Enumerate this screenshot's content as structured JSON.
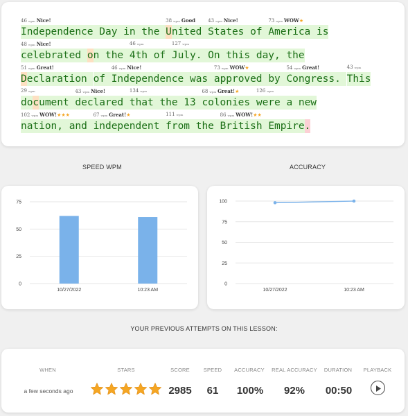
{
  "typing": {
    "lines": [
      {
        "words": [
          {
            "text": "Independence",
            "wpm": "46",
            "label": "Nice!",
            "stars": "",
            "hl": []
          },
          {
            "text": "Day",
            "wpm": "",
            "label": "",
            "stars": "",
            "hl": []
          },
          {
            "text": "in",
            "wpm": "",
            "label": "",
            "stars": "",
            "hl": []
          },
          {
            "text": "the",
            "wpm": "",
            "label": "",
            "stars": "",
            "hl": []
          },
          {
            "text": "United",
            "wpm": "38",
            "label": "Good",
            "stars": "",
            "hl": [
              0
            ]
          },
          {
            "text": "States",
            "wpm": "43",
            "label": "Nice!",
            "stars": "",
            "hl": []
          },
          {
            "text": "of",
            "wpm": "",
            "label": "",
            "stars": "",
            "hl": []
          },
          {
            "text": "America",
            "wpm": "73",
            "label": "WOW",
            "stars": "★",
            "hl": []
          },
          {
            "text": "is",
            "wpm": "",
            "label": "",
            "stars": "",
            "hl": []
          }
        ]
      },
      {
        "words": [
          {
            "text": "celebrated",
            "wpm": "48",
            "label": "Nice!",
            "stars": "",
            "hl": []
          },
          {
            "text": "on",
            "wpm": "",
            "label": "",
            "stars": "",
            "hl": [
              0
            ]
          },
          {
            "text": "the",
            "wpm": "",
            "label": "",
            "stars": "",
            "hl": []
          },
          {
            "text": "4th",
            "wpm": "46",
            "label": "",
            "stars": "",
            "hl": []
          },
          {
            "text": "of",
            "wpm": "",
            "label": "",
            "stars": "",
            "hl": []
          },
          {
            "text": "July.",
            "wpm": "127",
            "label": "",
            "stars": "",
            "hl": []
          },
          {
            "text": "On",
            "wpm": "",
            "label": "",
            "stars": "",
            "hl": []
          },
          {
            "text": "this",
            "wpm": "",
            "label": "",
            "stars": "",
            "hl": []
          },
          {
            "text": "day,",
            "wpm": "",
            "label": "",
            "stars": "",
            "hl": []
          },
          {
            "text": "the",
            "wpm": "",
            "label": "",
            "stars": "",
            "hl": []
          }
        ]
      },
      {
        "words": [
          {
            "text": "Declaration",
            "wpm": "51",
            "label": "Great!",
            "stars": "",
            "hl": [
              0
            ]
          },
          {
            "text": "of",
            "wpm": "",
            "label": "",
            "stars": "",
            "hl": []
          },
          {
            "text": "Independence",
            "wpm": "46",
            "label": "Nice!",
            "stars": "",
            "hl": []
          },
          {
            "text": "was",
            "wpm": "",
            "label": "",
            "stars": "",
            "hl": []
          },
          {
            "text": "approved",
            "wpm": "73",
            "label": "WOW",
            "stars": "★",
            "hl": []
          },
          {
            "text": "by",
            "wpm": "",
            "label": "",
            "stars": "",
            "hl": []
          },
          {
            "text": "Congress.",
            "wpm": "54",
            "label": "Great!",
            "stars": "",
            "hl": []
          },
          {
            "text": "This",
            "wpm": "43",
            "label": "",
            "stars": "",
            "hl": []
          }
        ]
      },
      {
        "words": [
          {
            "text": "document",
            "wpm": "29",
            "label": "",
            "stars": "",
            "hl": [
              2
            ]
          },
          {
            "text": "declared",
            "wpm": "43",
            "label": "Nice!",
            "stars": "",
            "hl": []
          },
          {
            "text": "that",
            "wpm": "134",
            "label": "",
            "stars": "",
            "hl": []
          },
          {
            "text": "the",
            "wpm": "",
            "label": "",
            "stars": "",
            "hl": []
          },
          {
            "text": "13",
            "wpm": "",
            "label": "",
            "stars": "",
            "hl": []
          },
          {
            "text": "colonies",
            "wpm": "68",
            "label": "Great!",
            "stars": "★",
            "hl": []
          },
          {
            "text": "were",
            "wpm": "126",
            "label": "",
            "stars": "",
            "hl": []
          },
          {
            "text": "a",
            "wpm": "",
            "label": "",
            "stars": "",
            "hl": []
          },
          {
            "text": "new",
            "wpm": "",
            "label": "",
            "stars": "",
            "hl": []
          }
        ]
      },
      {
        "words": [
          {
            "text": "nation,",
            "wpm": "102",
            "label": "WOW!",
            "stars": "★★★",
            "hl": []
          },
          {
            "text": "and",
            "wpm": "",
            "label": "",
            "stars": "",
            "hl": []
          },
          {
            "text": "independent",
            "wpm": "67",
            "label": "Great!",
            "stars": "★",
            "hl": []
          },
          {
            "text": "from",
            "wpm": "111",
            "label": "",
            "stars": "",
            "hl": []
          },
          {
            "text": "the",
            "wpm": "",
            "label": "",
            "stars": "",
            "hl": []
          },
          {
            "text": "British",
            "wpm": "86",
            "label": "WOW!",
            "stars": "★★",
            "hl": []
          },
          {
            "text": "Empire.",
            "wpm": "",
            "label": "",
            "stars": "",
            "hl": [],
            "err": [
              6
            ]
          }
        ]
      }
    ],
    "wpm_unit": "wpm"
  },
  "speed_title": "SPEED WPM",
  "accuracy_title": "ACCURACY",
  "chart_data": [
    {
      "type": "bar",
      "title": "SPEED WPM",
      "categories": [
        "10/27/2022",
        "10:23 AM"
      ],
      "values": [
        62,
        61
      ],
      "ylim": [
        0,
        75
      ],
      "yticks": [
        0,
        25,
        50,
        75
      ],
      "color": "#7ab2ea",
      "grid": true
    },
    {
      "type": "line",
      "title": "ACCURACY",
      "categories": [
        "10/27/2022",
        "10:23 AM"
      ],
      "values": [
        98,
        100
      ],
      "ylim": [
        0,
        100
      ],
      "yticks": [
        0,
        25,
        50,
        75,
        100
      ],
      "color": "#7ab2ea",
      "grid": true
    }
  ],
  "attempts_title": "YOUR PREVIOUS ATTEMPTS ON THIS LESSON:",
  "attempts": {
    "headers": {
      "when": "WHEN",
      "stars": "STARS",
      "score": "SCORE",
      "speed": "SPEED",
      "accuracy": "ACCURACY",
      "real_accuracy": "REAL ACCURACY",
      "duration": "DURATION",
      "playback": "PLAYBACK"
    },
    "row": {
      "when": "a few seconds ago",
      "stars": 5,
      "score": "2985",
      "speed": "61",
      "accuracy": "100%",
      "real_accuracy": "92%",
      "duration": "00:50",
      "playback_icon": "play-icon"
    },
    "star_color": "#f5a623"
  }
}
